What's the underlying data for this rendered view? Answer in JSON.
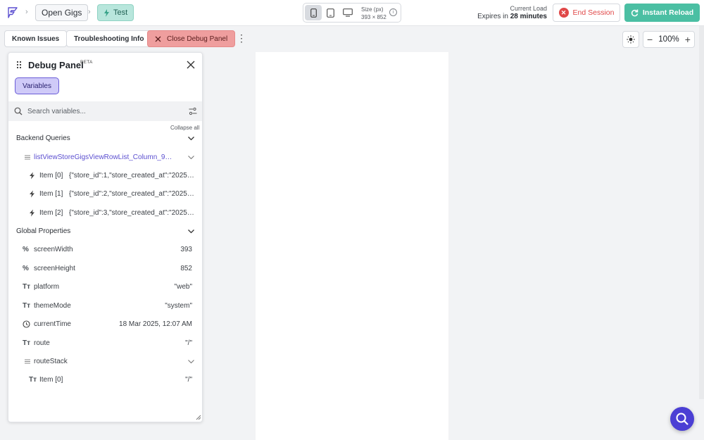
{
  "breadcrumb": {
    "project": "Open Gigs",
    "page": "Test"
  },
  "device": {
    "size_label": "Size (px)",
    "size_value": "393 × 852"
  },
  "session": {
    "load_label": "Current Load",
    "expires_prefix": "Expires in",
    "expires_value": "28 minutes",
    "end_label": "End Session",
    "reload_label": "Instant Reload"
  },
  "toolbar": {
    "known_issues": "Known Issues",
    "troubleshooting": "Troubleshooting Info",
    "close_debug": "Close Debug Panel",
    "zoom": "100%"
  },
  "panel": {
    "title": "Debug Panel",
    "badge": "BETA",
    "tab_variables": "Variables",
    "search_placeholder": "Search variables...",
    "collapse_all": "Collapse all",
    "backend_title": "Backend Queries",
    "query_name": "listViewStoreGigsViewRowList_Column_9mzq...",
    "items": [
      {
        "label": "Item [0]",
        "value": "{\"store_id\":1,\"store_created_at\":\"2025-0..."
      },
      {
        "label": "Item [1]",
        "value": "{\"store_id\":2,\"store_created_at\":\"2025-03..."
      },
      {
        "label": "Item [2]",
        "value": "{\"store_id\":3,\"store_created_at\":\"2025-0..."
      }
    ],
    "global_title": "Global Properties",
    "props": [
      {
        "name": "screenWidth",
        "value": "393",
        "icon": "percent-icon"
      },
      {
        "name": "screenHeight",
        "value": "852",
        "icon": "percent-icon"
      },
      {
        "name": "platform",
        "value": "\"web\"",
        "icon": "text-type-icon"
      },
      {
        "name": "themeMode",
        "value": "\"system\"",
        "icon": "text-type-icon"
      },
      {
        "name": "currentTime",
        "value": "18 Mar 2025, 12:07 AM",
        "icon": "clock-icon"
      },
      {
        "name": "route",
        "value": "\"/\"",
        "icon": "text-type-icon"
      },
      {
        "name": "routeStack",
        "value": "",
        "icon": "list-icon"
      }
    ],
    "route_item": {
      "label": "Item [0]",
      "value": "\"/\""
    }
  },
  "colors": {
    "accent": "#4b3fd4",
    "reload": "#4bbfa3",
    "danger": "#e04848",
    "test_tab": "#b8e6dc",
    "variables_tab": "#cfcaf8"
  }
}
